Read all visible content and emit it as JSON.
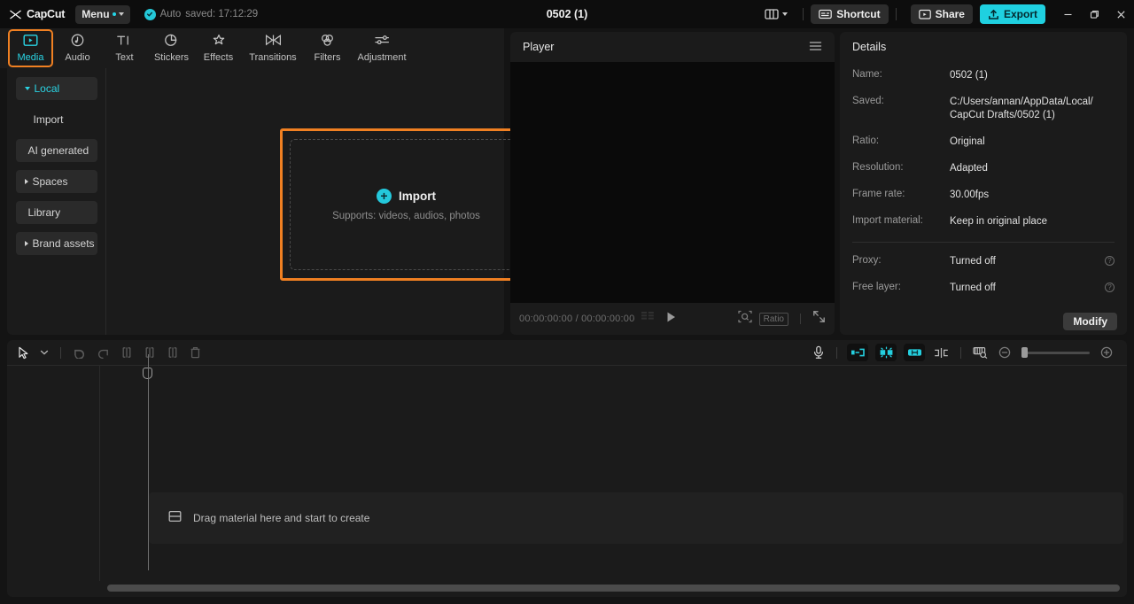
{
  "app": {
    "name": "CapCut",
    "logo_icon": "capcut-logo-icon"
  },
  "titlebar": {
    "menu_label": "Menu",
    "menu_caret_icon": "chevron-down-icon",
    "autosave_status_icon": "check-circle-icon",
    "autosave_prefix": "Auto",
    "autosave_text": "saved: 17:12:29",
    "project_title": "0502 (1)",
    "layout_icon": "layout-panels-icon",
    "layout_caret_icon": "chevron-down-icon",
    "shortcut_label": "Shortcut",
    "shortcut_icon": "keyboard-icon",
    "share_label": "Share",
    "share_icon": "share-video-icon",
    "export_label": "Export",
    "export_icon": "export-upload-icon",
    "minimize_icon": "minimize-icon",
    "maximize_icon": "maximize-restore-icon",
    "close_icon": "close-icon"
  },
  "tabs": [
    {
      "label": "Media",
      "icon": "media-play-frame-icon",
      "active": true
    },
    {
      "label": "Audio",
      "icon": "audio-note-icon",
      "active": false
    },
    {
      "label": "Text",
      "icon": "text-ti-icon",
      "active": false
    },
    {
      "label": "Stickers",
      "icon": "sticker-icon",
      "active": false
    },
    {
      "label": "Effects",
      "icon": "effects-sparkle-icon",
      "active": false
    },
    {
      "label": "Transitions",
      "icon": "transitions-bowtie-icon",
      "active": false
    },
    {
      "label": "Filters",
      "icon": "filters-circles-icon",
      "active": false
    },
    {
      "label": "Adjustment",
      "icon": "adjustment-sliders-icon",
      "active": false
    }
  ],
  "sidebar": {
    "items": [
      {
        "label": "Local",
        "expandable": true,
        "expanded": true,
        "active": true,
        "boxed": true
      },
      {
        "label": "Import",
        "expandable": false,
        "active": false,
        "boxed": false
      },
      {
        "label": "AI generated",
        "expandable": false,
        "active": false,
        "boxed": true
      },
      {
        "label": "Spaces",
        "expandable": true,
        "expanded": false,
        "active": false,
        "boxed": true
      },
      {
        "label": "Library",
        "expandable": false,
        "active": false,
        "boxed": true
      },
      {
        "label": "Brand assets",
        "expandable": true,
        "expanded": false,
        "active": false,
        "boxed": true
      }
    ]
  },
  "dropzone": {
    "import_label": "Import",
    "plus_icon": "plus-circle-icon",
    "supports_text": "Supports: videos, audios, photos",
    "highlighted": true
  },
  "player": {
    "title": "Player",
    "menu_icon": "hamburger-menu-icon",
    "current_time": "00:00:00:00",
    "separator": "/",
    "total_time": "00:00:00:00",
    "timecode_combined": "00:00:00:00 / 00:00:00:00",
    "frames_icon": "frame-grid-icon",
    "play_icon": "play-icon",
    "magnifier_icon": "zoom-fit-icon",
    "ratio_label": "Ratio",
    "fullscreen_icon": "fullscreen-icon"
  },
  "details": {
    "title": "Details",
    "rows": [
      {
        "key": "Name:",
        "value": "0502 (1)",
        "help": false
      },
      {
        "key": "Saved:",
        "value": "C:/Users/annan/AppData/Local/\nCapCut Drafts/0502 (1)",
        "help": false
      },
      {
        "key": "Ratio:",
        "value": "Original",
        "help": false
      },
      {
        "key": "Resolution:",
        "value": "Adapted",
        "help": false
      },
      {
        "key": "Frame rate:",
        "value": "30.00fps",
        "help": false
      },
      {
        "key": "Import material:",
        "value": "Keep in original place",
        "help": false
      }
    ],
    "rows_after_divider": [
      {
        "key": "Proxy:",
        "value": "Turned off",
        "help": true,
        "help_icon": "help-circle-icon"
      },
      {
        "key": "Free layer:",
        "value": "Turned off",
        "help": true,
        "help_icon": "help-circle-icon"
      }
    ],
    "modify_label": "Modify"
  },
  "timeline": {
    "toolbar": {
      "select_icon": "cursor-arrow-icon",
      "select_caret_icon": "chevron-down-icon",
      "undo_icon": "undo-icon",
      "redo_icon": "redo-icon",
      "split_icon": "split-clip-icon",
      "trim_left_icon": "trim-left-icon",
      "trim_right_icon": "trim-right-icon",
      "delete_icon": "trash-delete-icon",
      "mic_icon": "microphone-record-icon",
      "auto_snap_icon": "auto-snap-icon",
      "magnet_icon": "magnet-snap-icon",
      "link_icon": "link-clips-icon",
      "mirror_icon": "mirror-split-icon",
      "keyframe_icon": "timeline-preview-icon",
      "zoom_out_icon": "zoom-out-icon",
      "zoom_in_icon": "zoom-in-icon",
      "zoom_level": 3
    },
    "playhead_icon": "playhead-marker-icon",
    "empty_track": {
      "icon": "add-track-icon",
      "label": "Drag material here and start to create"
    },
    "scrollbar_icon": "horizontal-scrollbar"
  },
  "colors": {
    "accent_cyan": "#24d0e0",
    "highlight_orange": "#f08022",
    "panel_bg": "#1b1b1b",
    "app_bg": "#141414",
    "titlebar_bg": "#0d0d0d",
    "text_primary": "#e8e8e8",
    "text_secondary": "#8d8d8d"
  }
}
